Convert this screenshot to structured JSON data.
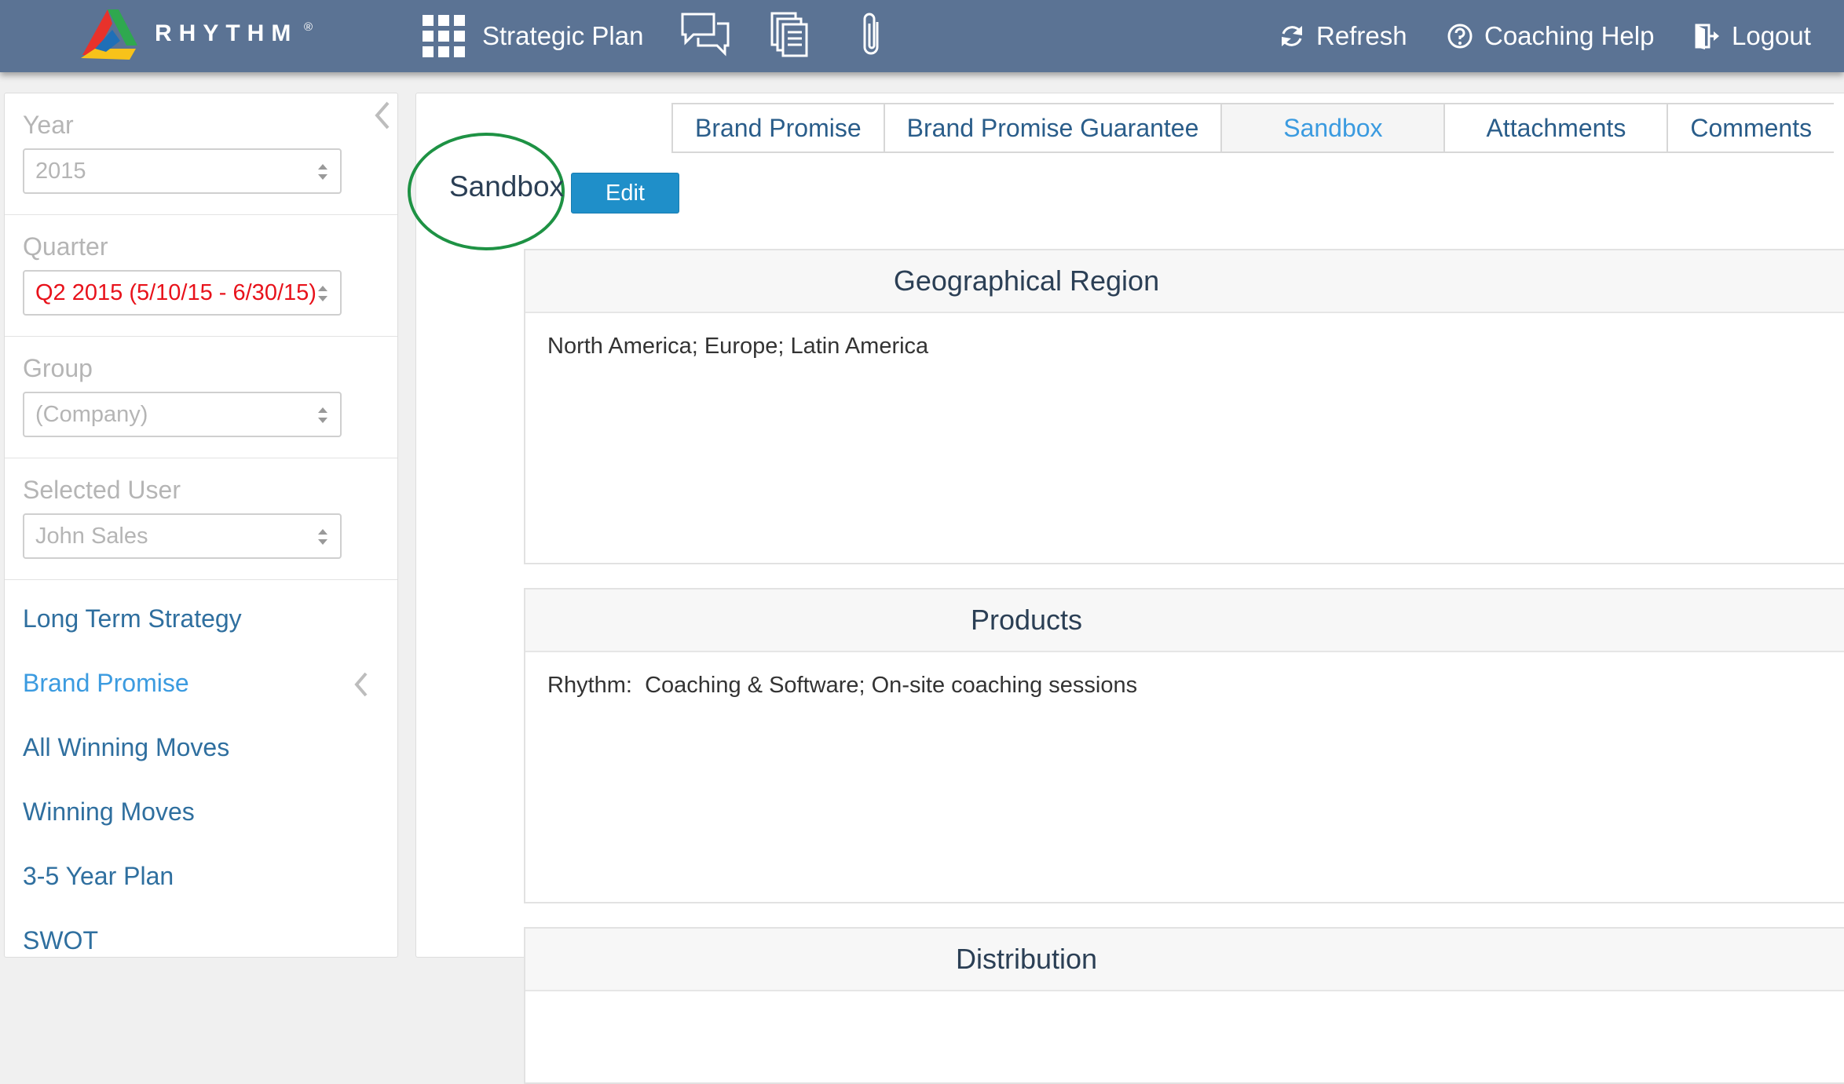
{
  "header": {
    "brand": "RHYTHM",
    "brand_mark": "®",
    "strategic_plan": "Strategic Plan",
    "refresh": "Refresh",
    "coaching_help": "Coaching Help",
    "logout": "Logout",
    "icons": [
      "grid-icon",
      "chat-icon",
      "documents-icon",
      "paperclip-icon",
      "refresh-icon",
      "help-icon",
      "logout-icon"
    ]
  },
  "sidebar": {
    "filters": [
      {
        "label": "Year",
        "value": "2015"
      },
      {
        "label": "Quarter",
        "value": "Q2 2015 (5/10/15 - 6/30/15)"
      },
      {
        "label": "Group",
        "value": "(Company)"
      },
      {
        "label": "Selected User",
        "value": "John Sales"
      }
    ],
    "nav": [
      {
        "label": "Long Term Strategy"
      },
      {
        "label": "Brand Promise"
      },
      {
        "label": "All Winning Moves"
      },
      {
        "label": "Winning Moves"
      },
      {
        "label": "3-5 Year Plan"
      },
      {
        "label": "SWOT"
      }
    ],
    "active_nav": "Brand Promise"
  },
  "main": {
    "tabs": [
      {
        "label": "Brand Promise"
      },
      {
        "label": "Brand Promise Guarantee"
      },
      {
        "label": "Sandbox"
      },
      {
        "label": "Attachments"
      },
      {
        "label": "Comments"
      }
    ],
    "active_tab": "Sandbox",
    "title": "Sandbox",
    "edit_label": "Edit",
    "cards": [
      {
        "title": "Geographical Region",
        "body": "North America; Europe; Latin America"
      },
      {
        "title": "Products",
        "body": "Rhythm:  Coaching & Software; On-site coaching sessions"
      },
      {
        "title": "Distribution",
        "body": ""
      }
    ]
  },
  "colors": {
    "topbar": "#5b7394",
    "link": "#2f6f9f",
    "active_link": "#3b9be0",
    "quarter_value": "#e8121b",
    "edit_button": "#1f8fc9",
    "highlight_circle": "#1e9244"
  }
}
